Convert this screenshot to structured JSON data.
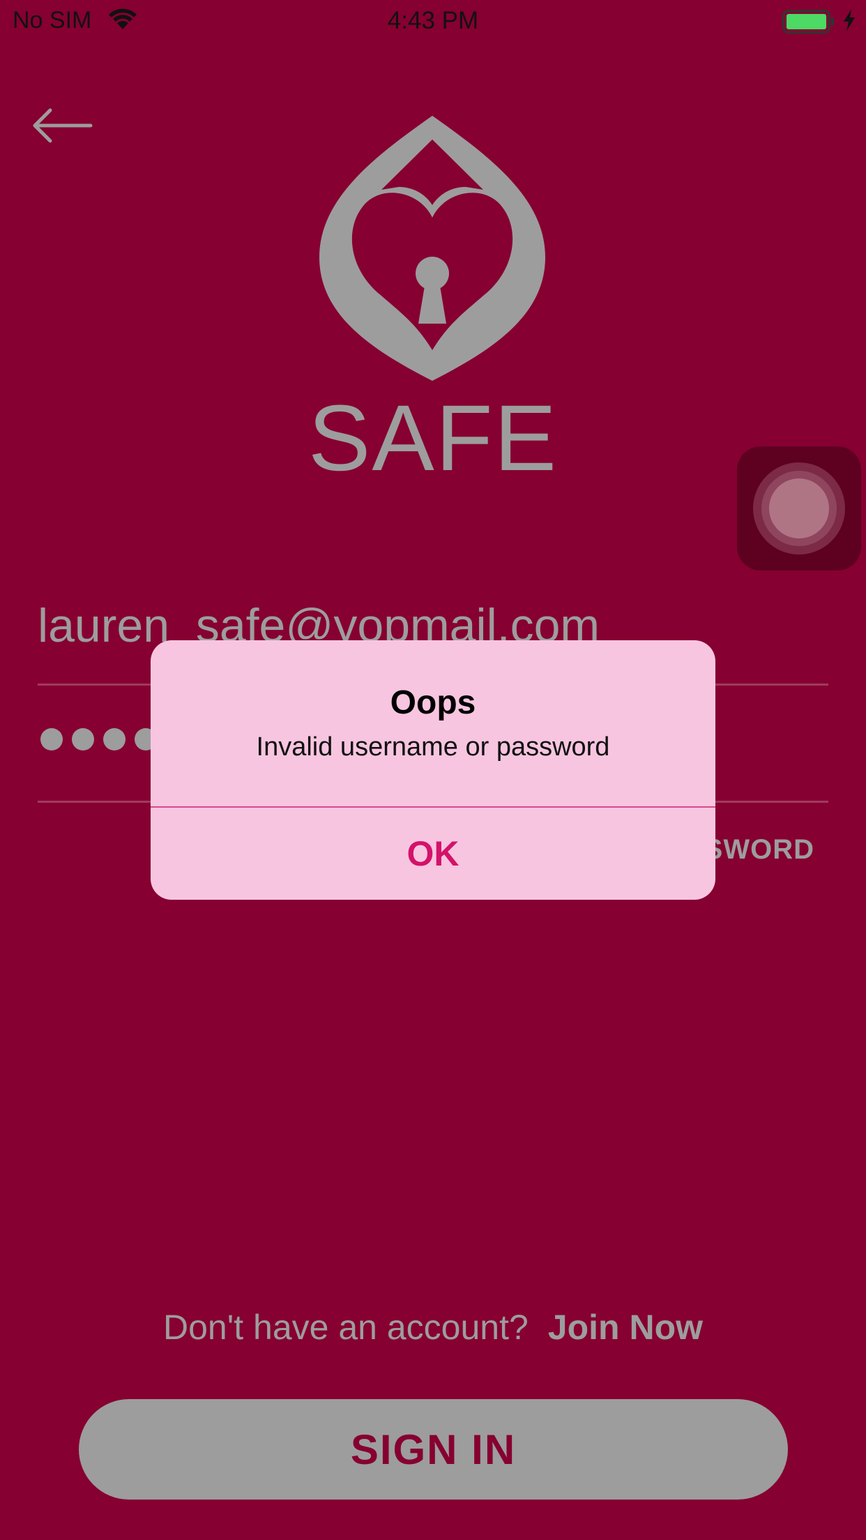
{
  "status_bar": {
    "carrier": "No SIM",
    "time": "4:43 PM",
    "icons": [
      "wifi-icon",
      "battery-icon",
      "charging-bolt-icon"
    ],
    "battery_color": "#4cd964"
  },
  "header": {
    "back_icon": "back-arrow-icon",
    "brand": "SAFE",
    "logo_icon": "heart-lock-logo"
  },
  "form": {
    "email_value": "lauren_safe@yopmail.com",
    "password_mask": "●●●●●",
    "forgot_password_visible_label": "SWORD"
  },
  "signup": {
    "prompt": "Don't have an account?",
    "link": "Join Now"
  },
  "signin_button": "SIGN IN",
  "alert": {
    "title": "Oops",
    "message": "Invalid username or password",
    "ok_label": "OK"
  },
  "colors": {
    "background": "#860031",
    "muted": "#9d9d9d",
    "alert_background": "#f8c5e0",
    "alert_action": "#d4116a"
  }
}
